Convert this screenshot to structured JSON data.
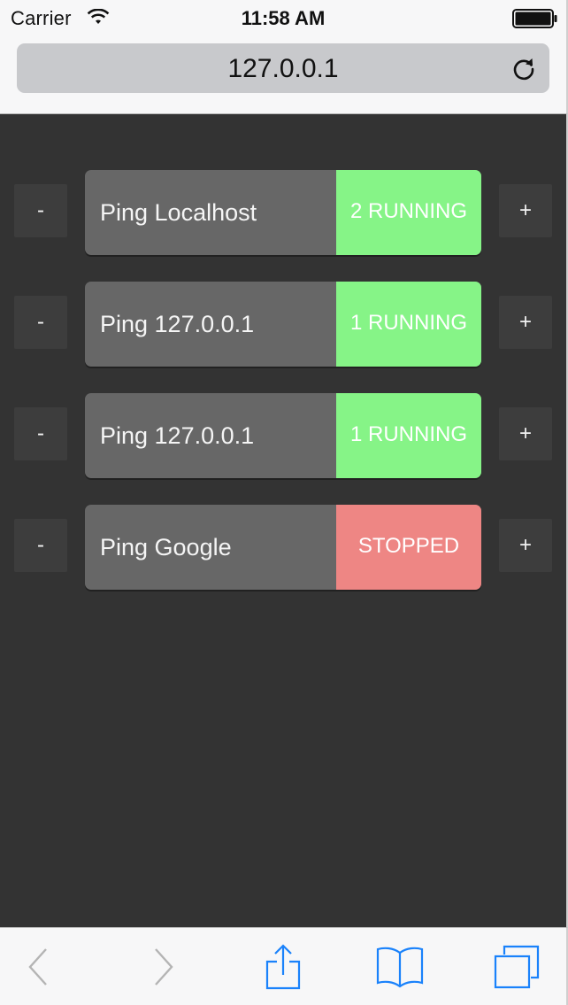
{
  "status_bar": {
    "carrier": "Carrier",
    "time": "11:58 AM",
    "wifi_icon": "wifi-icon",
    "battery_icon": "battery-icon"
  },
  "browser": {
    "url": "127.0.0.1",
    "reload_icon": "reload-icon"
  },
  "colors": {
    "page_background": "#333333",
    "card_background": "#676767",
    "button_background": "#3d3d3d",
    "running": "#86f487",
    "stopped": "#ee8684",
    "toolbar_accent": "#1a82fb",
    "toolbar_disabled": "#b4b4b4"
  },
  "controls": {
    "decrement_label": "-",
    "increment_label": "+"
  },
  "processes": [
    {
      "name": "Ping Localhost",
      "status": "2 RUNNING",
      "state": "running"
    },
    {
      "name": "Ping 127.0.0.1",
      "status": "1 RUNNING",
      "state": "running"
    },
    {
      "name": "Ping 127.0.0.1",
      "status": "1 RUNNING",
      "state": "running"
    },
    {
      "name": "Ping Google",
      "status": "STOPPED",
      "state": "stopped"
    }
  ],
  "toolbar": {
    "icons": [
      "back-icon",
      "forward-icon",
      "share-icon",
      "bookmarks-icon",
      "tabs-icon"
    ]
  }
}
